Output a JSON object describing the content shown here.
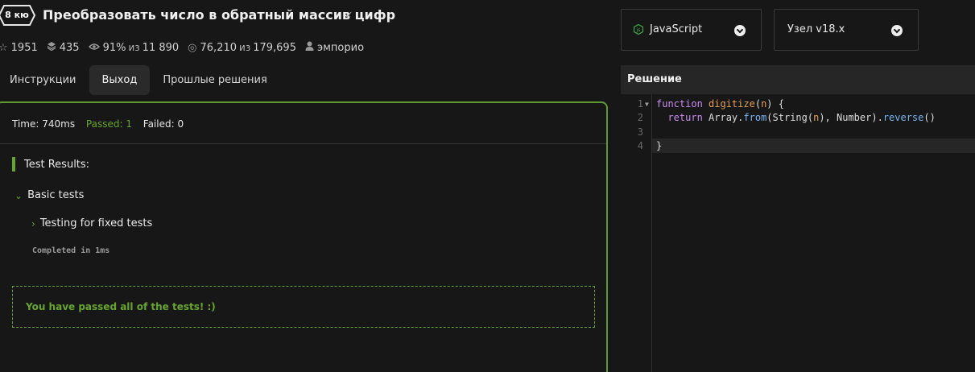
{
  "header": {
    "rank": "8 кю",
    "title": "Преобразовать число в обратный массив цифр",
    "stats": {
      "stars": "1951",
      "collections": "435",
      "satisfaction_pct": "91%",
      "satisfaction_of": "из",
      "satisfaction_total": "11 890",
      "completed": "76,210",
      "completed_of": "из",
      "completed_total": "179,695",
      "author": "эмпорио"
    }
  },
  "tabs": [
    {
      "label": "Инструкции",
      "active": false
    },
    {
      "label": "Выход",
      "active": true
    },
    {
      "label": "Прошлые решения",
      "active": false
    }
  ],
  "output": {
    "time": "Time: 740ms",
    "passed": "Passed: 1",
    "failed": "Failed: 0",
    "results_label": "Test Results:",
    "group": "Basic tests",
    "test": "Testing for fixed tests",
    "completed": "Completed in 1ms",
    "success": "You have passed all of the tests! :)"
  },
  "language_select": {
    "value": "JavaScript"
  },
  "runtime_select": {
    "value": "Узел v18.x"
  },
  "editor": {
    "title": "Решение",
    "line_numbers": [
      "1",
      "2",
      "3",
      "4"
    ],
    "lines": [
      {
        "kw": "function",
        "fn": " digitize",
        "p1": "(",
        "arg": "n",
        "p2": ") {"
      },
      {
        "kw": "  return",
        "obj": " Array",
        "dot": ".",
        "m1": "from",
        "p1": "(String(",
        "arg": "n",
        "p2": "), Number)",
        "dot2": ".",
        "m2": "reverse",
        "p3": "()"
      },
      {
        "text": ""
      },
      {
        "text": "}"
      }
    ]
  },
  "colors": {
    "accent_green": "#67a52f",
    "panel_border": "#5f9a2f",
    "background": "#171717"
  },
  "icons": [
    "star-icon",
    "stack-icon",
    "eye-icon",
    "target-icon",
    "user-icon",
    "check-icon",
    "chevron-down-icon",
    "chevron-right-icon",
    "javascript-icon"
  ]
}
